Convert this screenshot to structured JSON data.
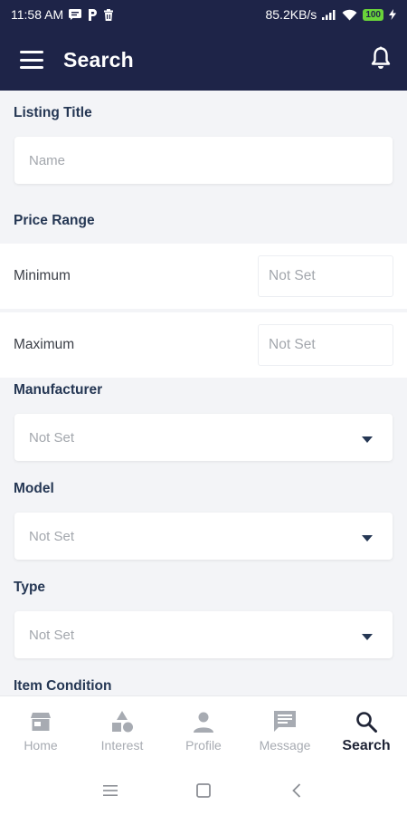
{
  "status_bar": {
    "time": "11:58 AM",
    "net_speed": "85.2KB/s",
    "battery": "100",
    "icons": [
      "message-icon",
      "p-icon",
      "trash-icon",
      "signal-icon",
      "wifi-icon",
      "battery-icon",
      "charging-icon"
    ]
  },
  "app_bar": {
    "title": "Search",
    "menu_icon": "hamburger-menu-icon",
    "notification_icon": "bell-icon"
  },
  "form": {
    "listing_title": {
      "label": "Listing Title",
      "placeholder": "Name"
    },
    "price_range": {
      "label": "Price Range",
      "minimum": {
        "label": "Minimum",
        "value": "Not Set"
      },
      "maximum": {
        "label": "Maximum",
        "value": "Not Set"
      }
    },
    "manufacturer": {
      "label": "Manufacturer",
      "value": "Not Set"
    },
    "model": {
      "label": "Model",
      "value": "Not Set"
    },
    "type": {
      "label": "Type",
      "value": "Not Set"
    },
    "item_condition": {
      "label": "Item Condition"
    }
  },
  "bottom_nav": {
    "items": [
      {
        "label": "Home",
        "icon": "store-icon",
        "active": false
      },
      {
        "label": "Interest",
        "icon": "shapes-icon",
        "active": false
      },
      {
        "label": "Profile",
        "icon": "person-icon",
        "active": false
      },
      {
        "label": "Message",
        "icon": "chat-icon",
        "active": false
      },
      {
        "label": "Search",
        "icon": "search-icon",
        "active": true
      }
    ]
  },
  "system_nav": {
    "icons": [
      "recents-icon",
      "home-square-icon",
      "back-icon"
    ]
  },
  "colors": {
    "app_bar": "#1e2448",
    "label": "#253754",
    "background": "#f3f4f7",
    "placeholder": "#a3a7ad",
    "nav_inactive": "#a7abb2"
  }
}
